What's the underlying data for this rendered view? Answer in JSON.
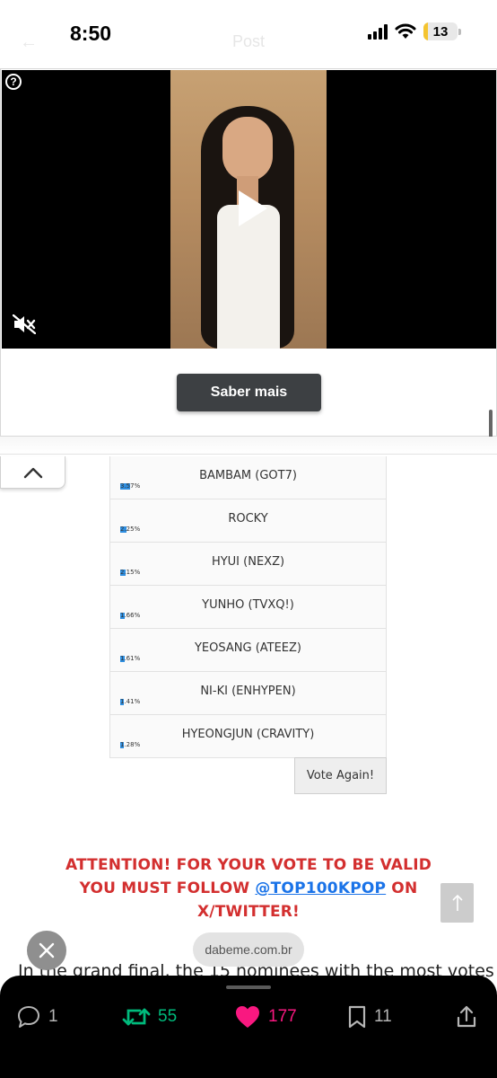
{
  "status_bar": {
    "time": "8:50",
    "battery": "13",
    "ghost_title": "Post"
  },
  "ad": {
    "help_glyph": "?",
    "cta_label": "Saber mais"
  },
  "poll": {
    "rows": [
      {
        "name": "BAMBAM (GOT7)",
        "percent": "3.57%"
      },
      {
        "name": "ROCKY",
        "percent": "2.25%"
      },
      {
        "name": "HYUI (NEXZ)",
        "percent": "2.15%"
      },
      {
        "name": "YUNHO (TVXQ!)",
        "percent": "1.66%"
      },
      {
        "name": "YEOSANG (ATEEZ)",
        "percent": "1.61%"
      },
      {
        "name": "NI-KI (ENHYPEN)",
        "percent": "1.41%"
      },
      {
        "name": "HYEONGJUN (CRAVITY)",
        "percent": "1.28%"
      }
    ],
    "vote_again_label": "Vote Again!"
  },
  "attention": {
    "line1": "ATTENTION! FOR YOUR VOTE TO BE VALID",
    "line2_prefix": "YOU MUST FOLLOW ",
    "handle": "@TOP100KPOP",
    "line2_suffix": " ON",
    "line3": "X/TWITTER!"
  },
  "browser": {
    "url": "dabeme.com.br"
  },
  "article": {
    "cut_text": "In the grand final, the 15 nominees with the most votes"
  },
  "actions": {
    "replies": "1",
    "reposts": "55",
    "likes": "177",
    "bookmarks": "11"
  },
  "colors": {
    "poll_bar": "#2e8ee0",
    "attention": "#d32f2f",
    "link": "#1a73e8",
    "repost": "#00ba7c",
    "like": "#f91880"
  }
}
